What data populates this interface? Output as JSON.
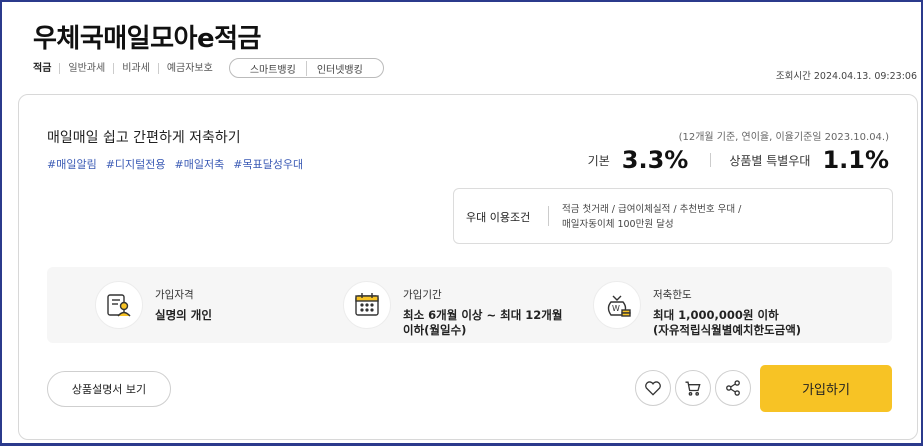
{
  "product": {
    "title": "우체국매일모아e적금"
  },
  "tags": [
    "적금",
    "일반과세",
    "비과세",
    "예금자보호"
  ],
  "channels": [
    "스마트뱅킹",
    "인터넷뱅킹"
  ],
  "view_time": "조회시간 2024.04.13. 09:23:06",
  "card": {
    "description": "매일매일 쉽고 간편하게 저축하기",
    "hashtags": [
      "#매일알림",
      "#디지털전용",
      "#매일저축",
      "#목표달성우대"
    ],
    "basis_note": "(12개월 기준, 연이율, 이율기준일 2023.10.04.)",
    "base_label": "기본",
    "base_rate": "3.3%",
    "special_label": "상품별 특별우대",
    "special_rate": "1.1%",
    "pref_label": "우대 이용조건",
    "pref_line1": "적금 첫거래  /  급여이체실적  /  추천번호 우대  /",
    "pref_line2": "매일자동이체 100만원 달성"
  },
  "info": {
    "eligibility": {
      "head": "가입자격",
      "value": "실명의 개인",
      "icon": "person-card-icon"
    },
    "period": {
      "head": "가입기간",
      "value1": "최소 6개월 이상 ~ 최대 12개월",
      "value2": "이하(월일수)",
      "icon": "calendar-icon"
    },
    "limit": {
      "head": "저축한도",
      "value1": "최대 1,000,000원 이하",
      "value2": "(자유적립식월별예치한도금액)",
      "icon": "money-bag-icon"
    }
  },
  "actions": {
    "manual": "상품설명서 보기",
    "join": "가입하기"
  },
  "colors": {
    "accent": "#f7c325",
    "hashtag": "#3b5bb5",
    "frame": "#2b3a8c"
  }
}
